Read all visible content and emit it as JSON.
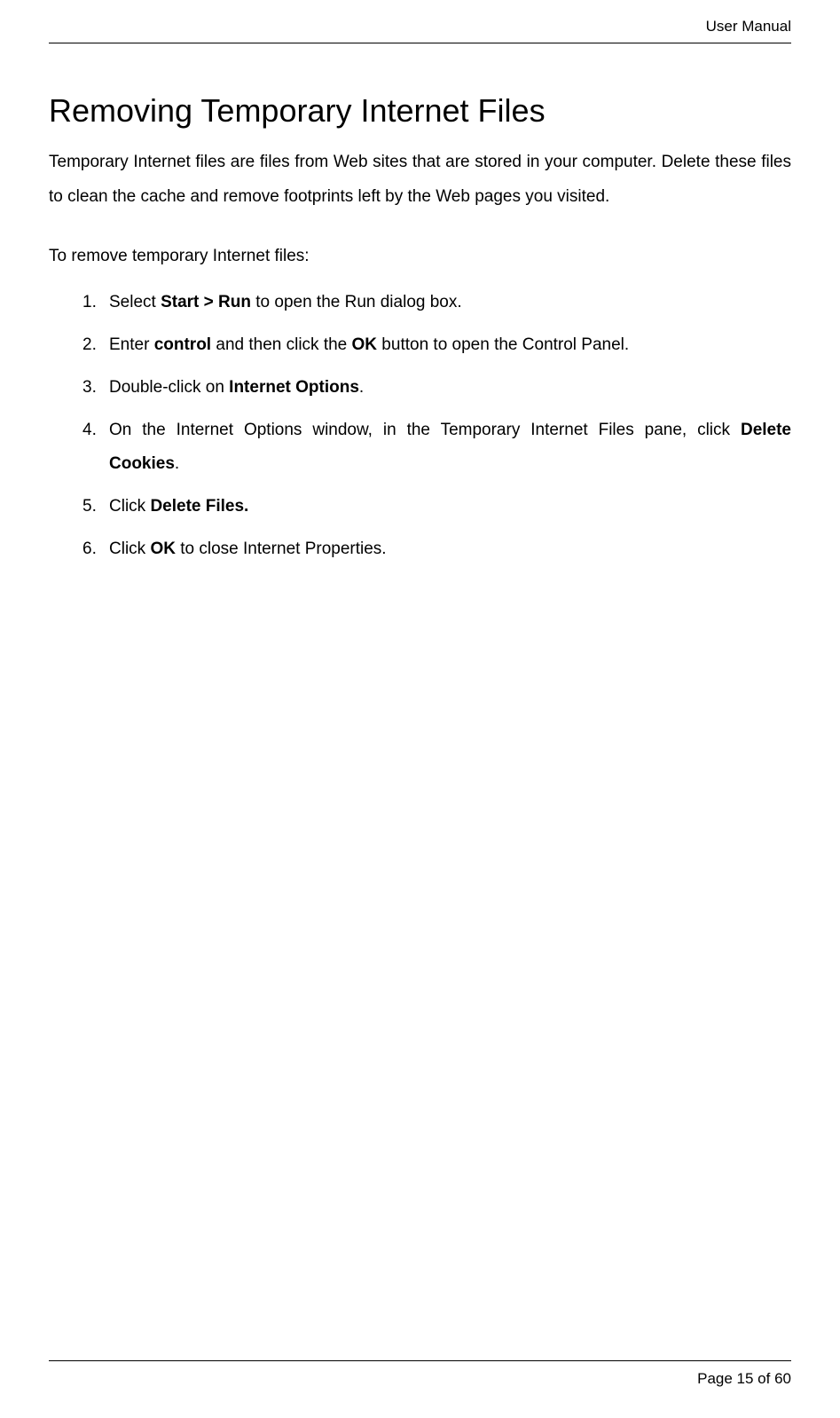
{
  "header": {
    "doc_title": "User Manual"
  },
  "content": {
    "title": "Removing Temporary Internet Files",
    "intro": "Temporary Internet files are files from Web sites that are stored in your computer. Delete these files to clean the cache and remove footprints left by the Web pages you visited.",
    "subhead": "To remove temporary Internet files:",
    "steps": [
      {
        "num": "1.",
        "pre": "Select ",
        "bold1": "Start > Run",
        "mid": " to open the Run dialog box.",
        "bold2": "",
        "post": ""
      },
      {
        "num": "2.",
        "pre": "Enter ",
        "bold1": "control",
        "mid": " and then click the ",
        "bold2": "OK",
        "post": " button to open the Control Panel."
      },
      {
        "num": "3.",
        "pre": "Double-click on ",
        "bold1": "Internet Options",
        "mid": ".",
        "bold2": "",
        "post": ""
      },
      {
        "num": "4.",
        "pre": "On the Internet Options window, in the Temporary Internet Files pane, click ",
        "bold1": "Delete Cookies",
        "mid": ".",
        "bold2": "",
        "post": ""
      },
      {
        "num": "5.",
        "pre": "Click ",
        "bold1": "Delete Files.",
        "mid": "",
        "bold2": "",
        "post": ""
      },
      {
        "num": "6.",
        "pre": "Click ",
        "bold1": "OK",
        "mid": " to close Internet Properties.",
        "bold2": "",
        "post": ""
      }
    ]
  },
  "footer": {
    "page_label": "Page 15 of 60"
  }
}
